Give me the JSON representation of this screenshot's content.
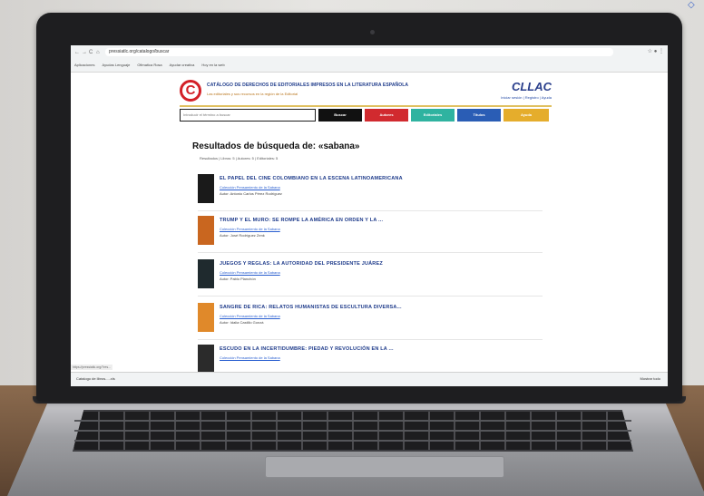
{
  "browser": {
    "url": "pressiatlc.org/catalogo/buscar",
    "nav_back": "←",
    "nav_forward": "→",
    "nav_reload": "C",
    "nav_home": "⌂",
    "menu": "☆ ● ⋮",
    "bookmarks": [
      "Aplicaciones",
      "Ayudas Lenguaje",
      "Ofimatica Rosa",
      "Ayudar creativa",
      "Hoy en la web"
    ]
  },
  "site": {
    "logo": "C",
    "title": "CATÁLOGO DE DERECHOS DE EDITORIALES IMPRESOS EN LA LITERATURA ESPAÑOLA",
    "subtitle": "Las editoriales y sus recursos en la región de la Editorial",
    "brand": "CLLAC",
    "header_links": "Iniciar sesión | Registro | Ayuda"
  },
  "search": {
    "placeholder": "Introducir el término a buscar",
    "buttons": [
      {
        "label": "Buscar",
        "color": "#111111"
      },
      {
        "label": "Autores",
        "color": "#d12a2f"
      },
      {
        "label": "Editoriales",
        "color": "#2fb3a0"
      },
      {
        "label": "Títulos",
        "color": "#2a5db5"
      },
      {
        "label": "Ayuda",
        "color": "#e5ad2c"
      }
    ]
  },
  "results": {
    "heading": "Resultados de búsqueda de: «sabana»",
    "filters": "Resultados | Libros: 5 | Autores: 5 | Editoriales: 5",
    "items": [
      {
        "title": "EL PAPEL DEL CINE COLOMBIANO EN LA ESCENA LATINOAMERICANA",
        "publisher": "Colección Pensamiento de la Sabana",
        "author": "Autor: Antonio Carlos Pérez Rodríguez",
        "cover_color": "#1a1a1a"
      },
      {
        "title": "TRUMP Y EL MURO: SE ROMPE LA AMÉRICA EN ORDEN Y LA ...",
        "publisher": "Colección Pensamiento de la Sabana",
        "author": "Autor: José Rodríguez Zenk",
        "cover_color": "#c9661f"
      },
      {
        "title": "JUEGOS Y REGLAS: LA AUTORIDAD DEL PRESIDENTE JUÁREZ",
        "publisher": "Colección Pensamiento de la Sabana",
        "author": "Autor: Pablo Planchón",
        "cover_color": "#1f2a2e"
      },
      {
        "title": "SANGRE DE RICA: RELATOS HUMANISTAS DE ESCULTURA DIVERSA...",
        "publisher": "Colección Pensamiento de la Sabana",
        "author": "Autor: Idalia Castillo Gonzá",
        "cover_color": "#e0892a"
      },
      {
        "title": "ESCUDO EN LA INCERTIDUMBRE: PIEDAD Y REVOLUCIÓN EN LA ...",
        "publisher": "Colección Pensamiento de la Sabana",
        "author": "",
        "cover_color": "#2b2b2b"
      }
    ]
  },
  "downloads": {
    "status_url": "https://pressiatlc.org/?res...",
    "item": "Catalogo de libros.....xls",
    "show_all": "Mostrar todo"
  }
}
